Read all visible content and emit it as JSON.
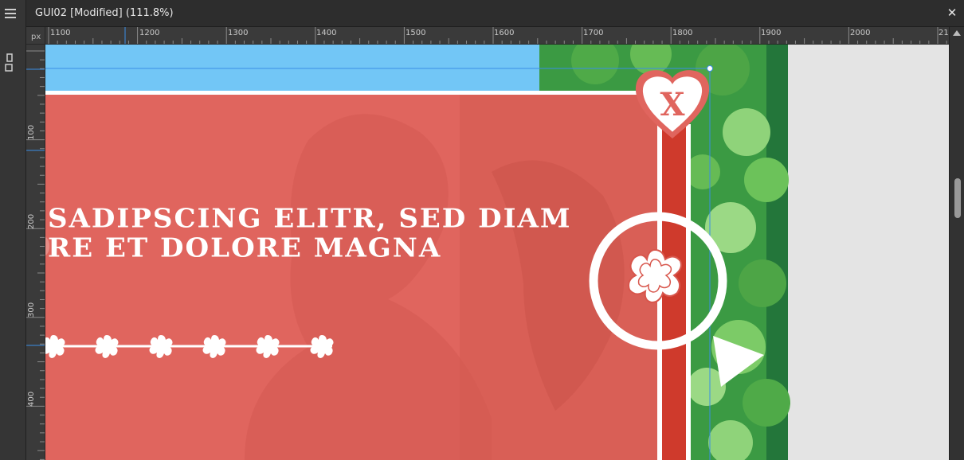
{
  "window": {
    "title": "GUI02 [Modified] (111.8%)"
  },
  "ruler": {
    "unit": "px",
    "horizontal_labels": [
      "1100",
      "1200",
      "1300",
      "1400",
      "1500",
      "1600",
      "1700",
      "1800",
      "1900",
      "2000",
      "21"
    ],
    "vertical_labels": [
      "100",
      "200",
      "300",
      "400"
    ]
  },
  "artboard": {
    "headline_line_1": "SADIPSCING ELITR, SED DIAM",
    "headline_line_2": "RE ET DOLORE MAGNA",
    "ghost_glyph": "O",
    "close_badge_label": "X",
    "colors": {
      "sky": "#72c6f6",
      "panel_red": "#e0655e",
      "bar_red": "#cf3a2c",
      "white": "#ffffff",
      "foliage_dark": "#2f8a3a",
      "foliage_light": "#8fd37a"
    }
  },
  "icons": {
    "menu": "hamburger-menu-icon",
    "tool": "crop-tool-icon",
    "close": "close-icon",
    "heart_close": "heart-close-badge",
    "flower": "sakura-flower-icon",
    "play": "play-triangle-icon",
    "scroll_up": "chevron-up-icon"
  }
}
